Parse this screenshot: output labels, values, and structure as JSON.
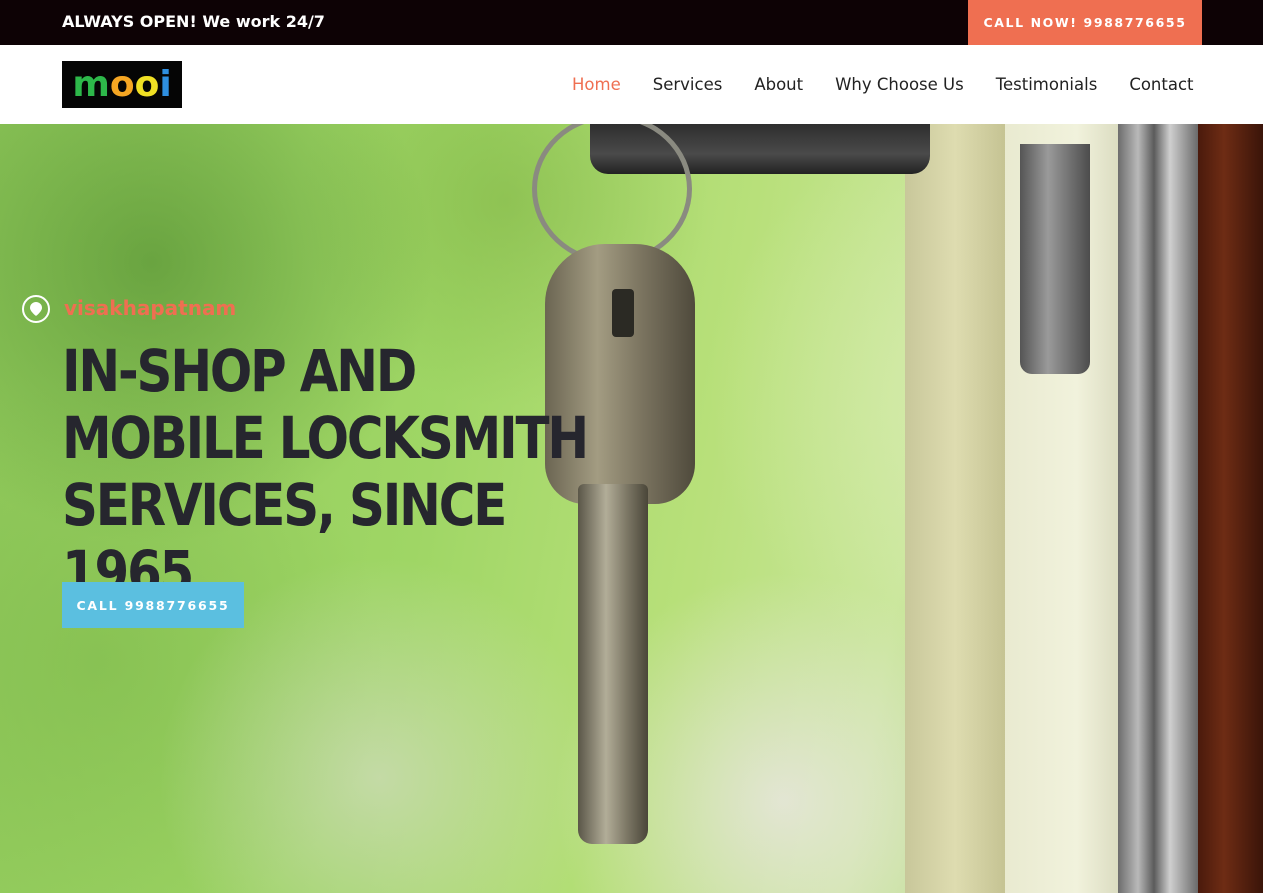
{
  "topbar": {
    "notice": "ALWAYS OPEN! We work 24/7",
    "call_now_label": "CALL NOW! 9988776655"
  },
  "header": {
    "logo_text": "mooi",
    "nav": [
      {
        "label": "Home",
        "active": true
      },
      {
        "label": "Services",
        "active": false
      },
      {
        "label": "About",
        "active": false
      },
      {
        "label": "Why Choose Us",
        "active": false
      },
      {
        "label": "Testimonials",
        "active": false
      },
      {
        "label": "Contact",
        "active": false
      }
    ]
  },
  "hero": {
    "location_icon": "map-pin-icon",
    "location": "visakhapatnam",
    "headline": "IN-SHOP AND MOBILE LOCKSMITH SERVICES, SINCE 1965",
    "cta_label": "CALL 9988776655"
  },
  "colors": {
    "accent": "#ef6f51",
    "cta": "#5bbfe0",
    "topbar_bg": "#0d0205",
    "headline": "#26262e"
  }
}
